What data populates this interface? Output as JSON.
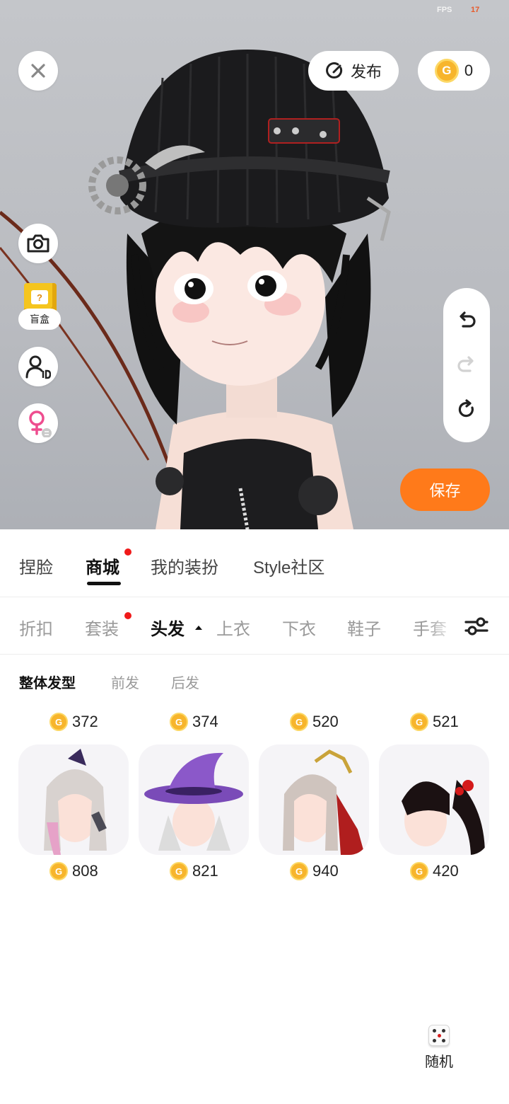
{
  "debug": {
    "fps_label": "FPS",
    "fps_value": "17"
  },
  "top": {
    "publish_label": "发布",
    "coin_balance": "0",
    "coin_symbol": "G",
    "save_label": "保存",
    "blind_box_label": "盲盒",
    "blind_box_mark": "?"
  },
  "tabs": [
    {
      "label": "捏脸",
      "active": false
    },
    {
      "label": "商城",
      "active": true
    },
    {
      "label": "我的装扮",
      "active": false
    },
    {
      "label": "Style社区",
      "active": false
    }
  ],
  "categories": [
    "折扣",
    "套装",
    "头发",
    "上衣",
    "下衣",
    "鞋子",
    "手套"
  ],
  "active_category": "头发",
  "hair_types": [
    "整体发型",
    "前发",
    "后发"
  ],
  "top_prices": [
    "372",
    "374",
    "520",
    "521"
  ],
  "items": [
    {
      "price": "808"
    },
    {
      "price": "821"
    },
    {
      "price": "940"
    },
    {
      "price": "420"
    }
  ],
  "random_label": "随机",
  "colors": {
    "accent": "#ff7a1a",
    "coin": "#f7b52c",
    "badge": "#f01a1a"
  }
}
